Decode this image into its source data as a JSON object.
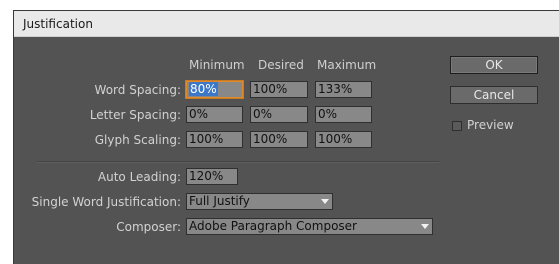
{
  "window": {
    "title": "Justification"
  },
  "columns": {
    "minimum": "Minimum",
    "desired": "Desired",
    "maximum": "Maximum"
  },
  "rows": {
    "word_spacing": {
      "label": "Word Spacing:",
      "minimum": "80%",
      "desired": "100%",
      "maximum": "133%"
    },
    "letter_spacing": {
      "label": "Letter Spacing:",
      "minimum": "0%",
      "desired": "0%",
      "maximum": "0%"
    },
    "glyph_scaling": {
      "label": "Glyph Scaling:",
      "minimum": "100%",
      "desired": "100%",
      "maximum": "100%"
    }
  },
  "auto_leading": {
    "label": "Auto Leading:",
    "value": "120%"
  },
  "single_word_justification": {
    "label": "Single Word Justification:",
    "value": "Full Justify"
  },
  "composer": {
    "label": "Composer:",
    "value": "Adobe Paragraph Composer"
  },
  "buttons": {
    "ok": "OK",
    "cancel": "Cancel"
  },
  "preview": {
    "label": "Preview",
    "checked": false
  }
}
